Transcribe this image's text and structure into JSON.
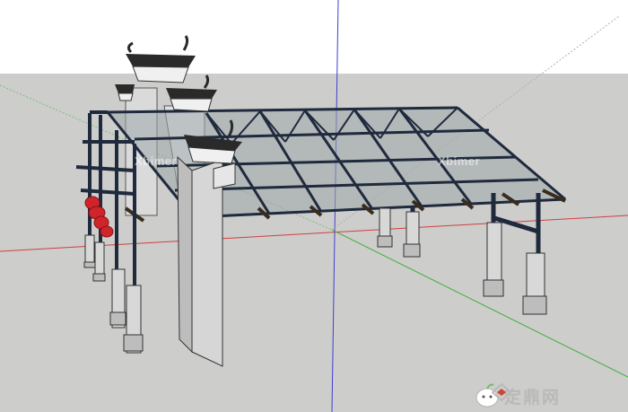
{
  "watermarks": {
    "left": "Xbimer",
    "right": "Xbimer"
  },
  "brand": {
    "text": "定鼎网"
  },
  "colors": {
    "sky": "#ffffff",
    "ground": "#cdcdcb",
    "steel": "#1f2a3d",
    "wall": "#e4e4e4",
    "roof_tile": "#2a2a2a",
    "lantern": "#d0242b",
    "glass": "#9ea7ac",
    "axis_red": "#d04040",
    "axis_green": "#3fae3f",
    "axis_blue": "#4040d0"
  },
  "icons": {
    "mascot": "mascot-icon",
    "logo": "dingding-logo-icon"
  }
}
